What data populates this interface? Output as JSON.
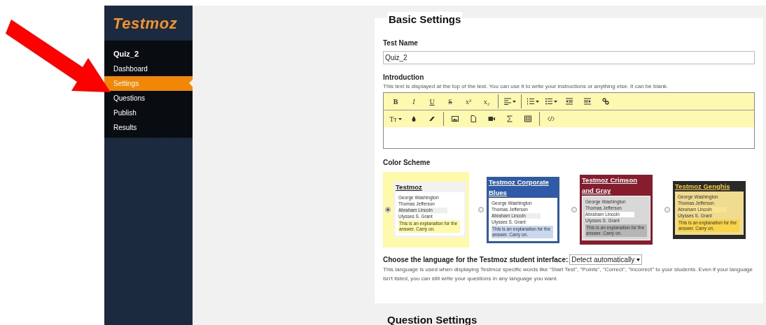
{
  "sidebar": {
    "logo": "Testmoz",
    "quiz_title": "Quiz_2",
    "items": [
      {
        "label": "Dashboard",
        "selected": false
      },
      {
        "label": "Settings",
        "selected": true
      },
      {
        "label": "Questions",
        "selected": false
      },
      {
        "label": "Publish",
        "selected": false
      },
      {
        "label": "Results",
        "selected": false
      }
    ]
  },
  "basic_settings": {
    "heading": "Basic Settings",
    "test_name": {
      "label": "Test Name",
      "value": "Quiz_2"
    },
    "introduction": {
      "label": "Introduction",
      "help": "This text is displayed at the top of the test. You can use it to write your instructions or anything else. It can be blank.",
      "toolbar_text_buttons": [
        "B",
        "I",
        "U",
        "S",
        "x²",
        "x₂"
      ],
      "font_size_button": "Tт"
    },
    "color_scheme": {
      "label": "Color Scheme",
      "options": [
        {
          "kind": "default",
          "title": "Testmoz",
          "selected": true,
          "color": "#f2f2f2",
          "lines": [
            "George Washington",
            "Thomas Jefferson",
            "Abraham Lincoln",
            "Ulysses S. Grant"
          ],
          "explanation": "This is an explanation for the answer. Carry on."
        },
        {
          "kind": "blue",
          "title": "Testmoz Corporate Blues",
          "selected": false,
          "color": "#2f5aa8",
          "lines": [
            "George Washington",
            "Thomas Jefferson",
            "Abraham Lincoln",
            "Ulysses S. Grant"
          ],
          "explanation": "This is an explanation for the answer. Carry on."
        },
        {
          "kind": "crimson",
          "title": "Testmoz Crimson and Gray",
          "selected": false,
          "color": "#861c2c",
          "lines": [
            "George Washington",
            "Thomas Jefferson",
            "Abraham Lincoln",
            "Ulysses S. Grant"
          ],
          "explanation": "This is an explanation for the answer. Carry on."
        },
        {
          "kind": "genghis",
          "title": "Testmoz Genghis",
          "selected": false,
          "color": "#2a2a2a",
          "lines": [
            "George Washington",
            "Thomas Jefferson",
            "Abraham Lincoln",
            "Ulysses S. Grant"
          ],
          "explanation": "This is an explanation for the answer. Carry on."
        }
      ]
    },
    "language": {
      "label": "Choose the language for the Testmoz student interface:",
      "value": "Detect automatically",
      "help": "This language is used when displaying Testmoz specific words like \"Start Test\", \"Points\", \"Correct\", \"Incorrect\" to your students. Even if your language isn't listed, you can still write your questions in any language you want."
    }
  },
  "next_section": {
    "heading": "Question Settings"
  }
}
